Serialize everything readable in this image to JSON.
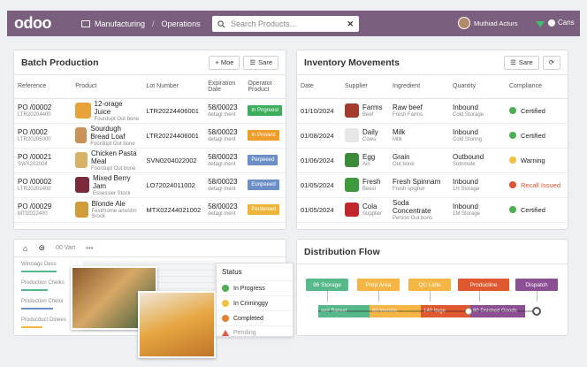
{
  "topbar": {
    "logo": "odoo",
    "app": "Manufacturing",
    "section": "Operations",
    "search_placeholder": "Search Products...",
    "user": "Muthiad Acturs",
    "company": "Cans"
  },
  "batch": {
    "title": "Batch Production",
    "btn_add": "+ Moe",
    "btn_save": "Sare",
    "columns": [
      "Reference",
      "Product",
      "Lot Number",
      "Expiration Date",
      "Operator Product"
    ],
    "rows": [
      {
        "ref": "PO /00002",
        "ref_sub": "LTR20204400",
        "product": "12-orage Juice",
        "product_sub": "Fourdupt Out bone",
        "lot": "LTR20224406001",
        "exp": "58/00023",
        "exp_sub": "detagl ment",
        "badge": "In Prigreest",
        "badge_color": "#3cae5c",
        "thumb": "#e8a23a"
      },
      {
        "ref": "PO /0002",
        "ref_sub": "LTR20205000",
        "product": "Sourdugh Bread Loaf",
        "product_sub": "Foordupt Out bone",
        "lot": "LTR20224406001",
        "exp": "58/00023",
        "exp_sub": "detagl ment",
        "badge": "In Proeest",
        "badge_color": "#ef9d2a",
        "thumb": "#c9925a"
      },
      {
        "ref": "PO /00021",
        "ref_sub": "SWX202004",
        "product": "Chicken Pasta Meal",
        "product_sub": "Foordupt Out bone",
        "lot": "SVN0204022002",
        "exp": "58/00023",
        "exp_sub": "detagl ment",
        "badge": "Perpeeed",
        "badge_color": "#6d8fc7",
        "thumb": "#d7b36a"
      },
      {
        "ref": "PO /00002",
        "ref_sub": "LTR20201400",
        "product": "Mixed Berry Jam",
        "product_sub": "Essessier Stock",
        "lot": "LO72024011002",
        "exp": "58/00023",
        "exp_sub": "detagl ment",
        "badge": "Eunpeeed",
        "badge_color": "#6d8fc7",
        "thumb": "#7a2a3a"
      },
      {
        "ref": "PO /00029",
        "ref_sub": "MTI2022400",
        "product": "Blonde Ale",
        "product_sub": "Festrhome anwshn Srock",
        "lot": "MTX02244021002",
        "exp": "58/00023",
        "exp_sub": "detagl ment",
        "badge": "Perdereed",
        "badge_color": "#efb43a",
        "thumb": "#d19a3a"
      }
    ]
  },
  "inventory": {
    "title": "Inventory Movements",
    "btn_save": "Sare",
    "columns": [
      "Date",
      "Supplier",
      "Ingredient",
      "Quantity",
      "Compliance"
    ],
    "rows": [
      {
        "date": "01/10/2024",
        "supplier": "Farms",
        "supplier_sub": "Beef",
        "ingredient": "Raw beef",
        "ingredient_sub": "Fresh Farms",
        "qty": "Inbound",
        "qty_sub": "Cold Storage",
        "status": "Certified",
        "status_color": "#4caf50",
        "thumb": "#a33b2f"
      },
      {
        "date": "01/08/2024",
        "supplier": "Daily",
        "supplier_sub": "Cows",
        "ingredient": "Milk",
        "ingredient_sub": "Milk",
        "qty": "Inbound",
        "qty_sub": "Cold Storing",
        "status": "Certified",
        "status_color": "#4caf50",
        "thumb": "#e7e7e7"
      },
      {
        "date": "01/06/2024",
        "supplier": "Egg",
        "supplier_sub": "Ain",
        "ingredient": "Grain",
        "ingredient_sub": "Out bone",
        "qty": "Outbound",
        "qty_sub": "Sotnmete",
        "status": "Warning",
        "status_color": "#f0c040",
        "thumb": "#3a8a3a"
      },
      {
        "date": "01/05/2024",
        "supplier": "Fresh",
        "supplier_sub": "Beesi",
        "ingredient": "Fresh Spinnam",
        "ingredient_sub": "Fresh spigher",
        "qty": "Inbound",
        "qty_sub": "1H Storage",
        "status": "Recall Issued",
        "status_color": "#e0522f",
        "thumb": "#3f9a3f"
      },
      {
        "date": "01/05/2024",
        "supplier": "Cola",
        "supplier_sub": "Supplier",
        "ingredient": "Soda Concentrate",
        "ingredient_sub": "Person Out bons",
        "qty": "Inbound",
        "qty_sub": "1M Storage",
        "status": "Certified",
        "status_color": "#4caf50",
        "thumb": "#c0262b"
      }
    ]
  },
  "overview": {
    "toolbar_label": "00 Vart",
    "rows": [
      "Winclags Dess",
      "Production Chelks",
      "Production Cheloi",
      "Producduct Dinees"
    ],
    "status_title": "Status",
    "statuses": [
      {
        "label": "In Progress",
        "color": "#4caf50"
      },
      {
        "label": "In Criminggy",
        "color": "#f0c040"
      },
      {
        "label": "Completed",
        "color": "#e0822f"
      },
      {
        "label": "Pending",
        "color": "#e05a3a"
      }
    ]
  },
  "flow": {
    "title": "Distribution Flow",
    "stages": [
      {
        "label": "96 Storage",
        "color": "#57b98b"
      },
      {
        "label": "Prep Area",
        "color": "#f5b646"
      },
      {
        "label": "QC Lidle",
        "color": "#f5b646"
      },
      {
        "label": "Producline",
        "color": "#e0582f"
      },
      {
        "label": "Dispatch",
        "color": "#8d4f93"
      }
    ],
    "segments": [
      {
        "label": "ae# Sareet",
        "color": "#57b98b"
      },
      {
        "label": "60 Ineratie",
        "color": "#f5b646"
      },
      {
        "label": "140 Itage",
        "color": "#e0582f"
      },
      {
        "label": "80 Dnished Goods",
        "color": "#8d4f93"
      }
    ]
  }
}
